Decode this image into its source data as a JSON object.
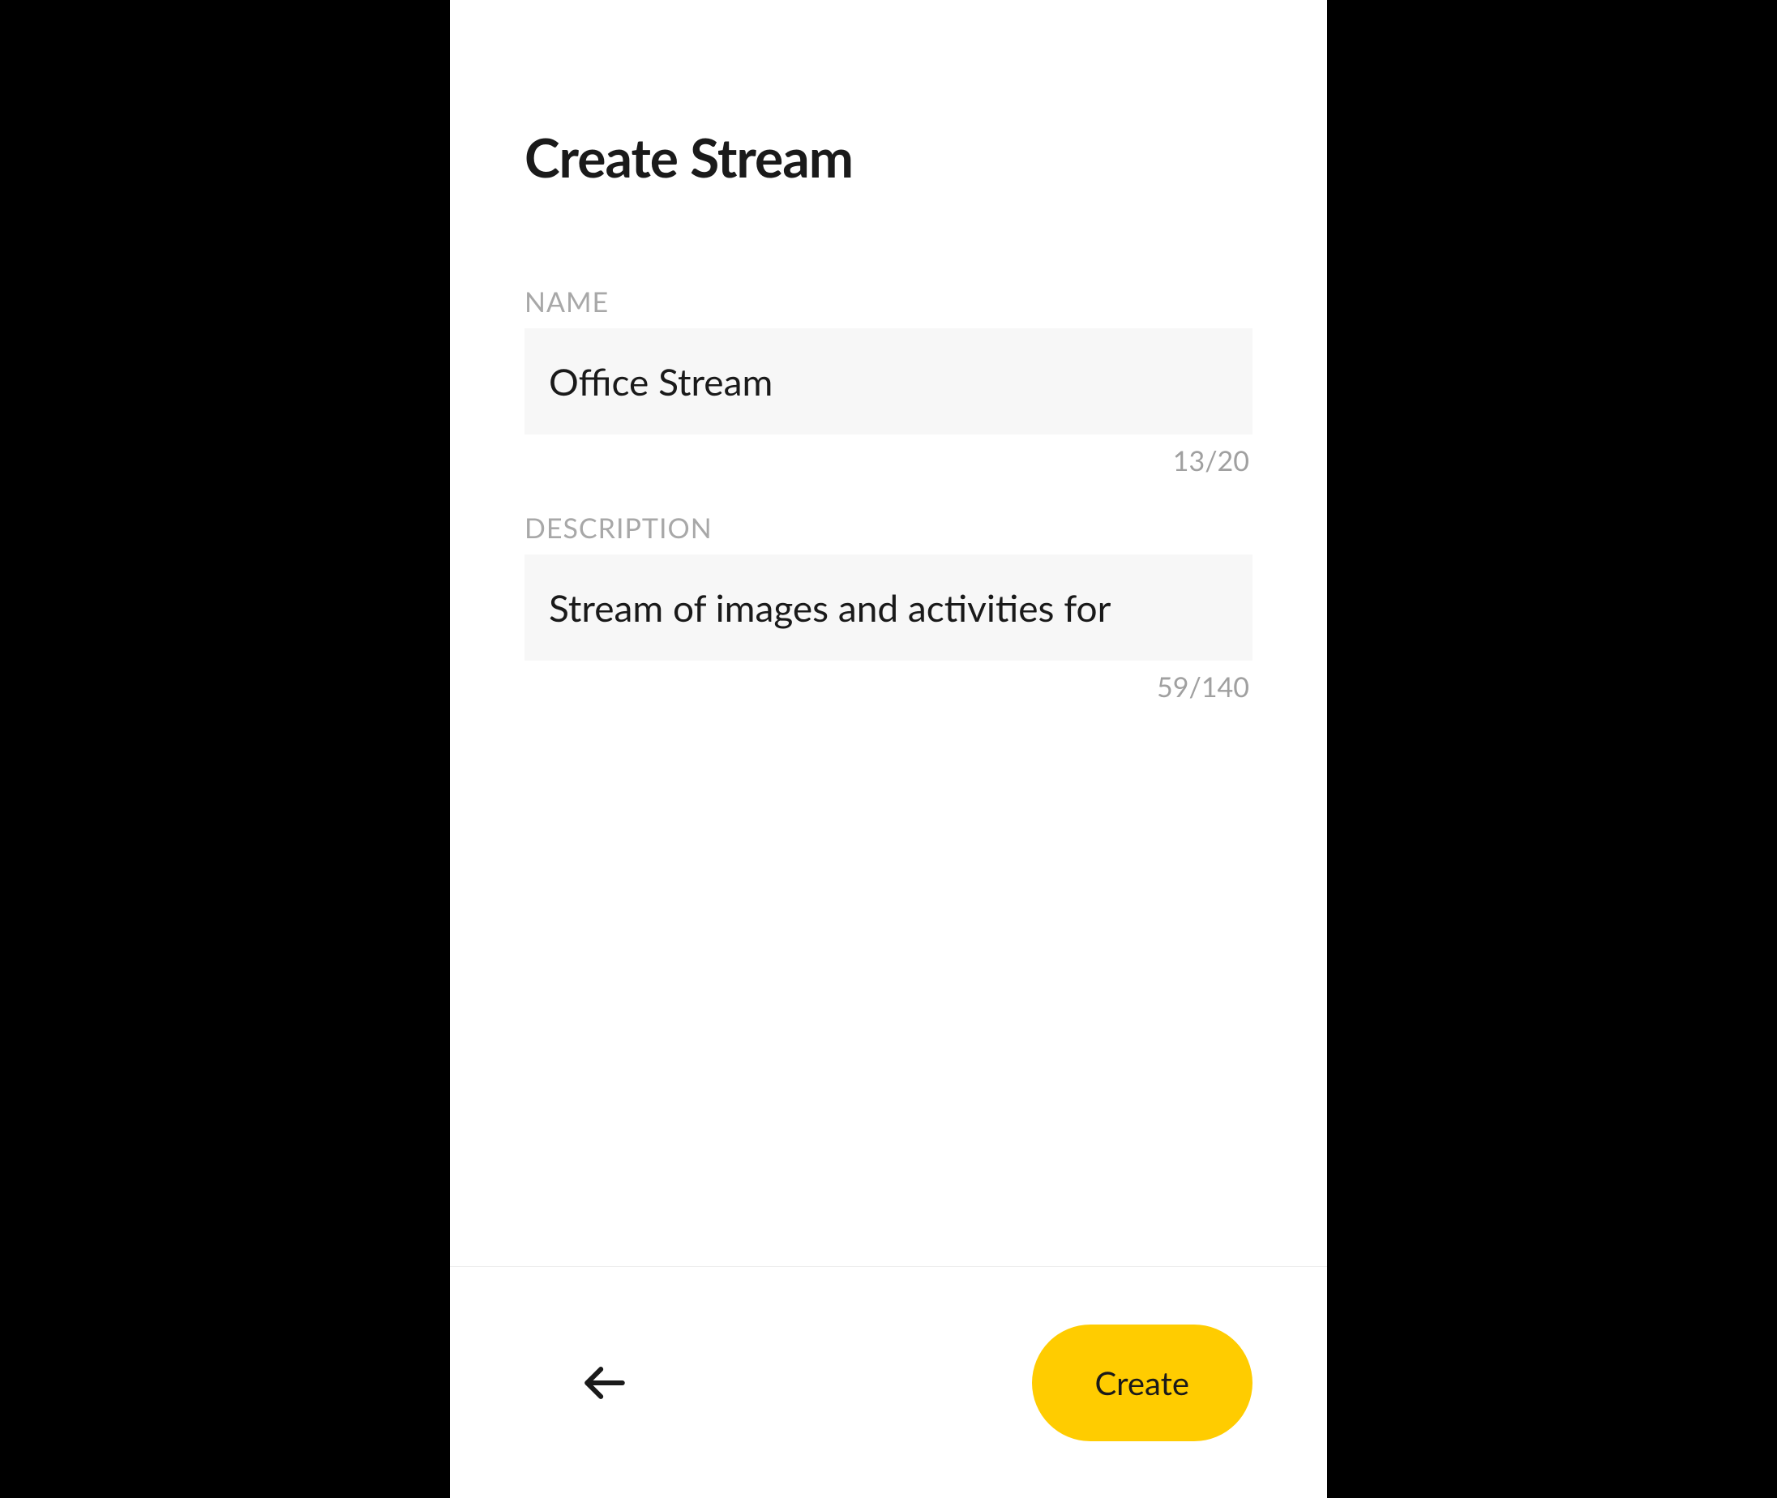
{
  "header": {
    "title": "Create Stream"
  },
  "form": {
    "name": {
      "label": "NAME",
      "value": "Office Stream",
      "counter": "13/20"
    },
    "description": {
      "label": "DESCRIPTION",
      "value": "Stream of images and activities for",
      "counter": "59/140"
    }
  },
  "footer": {
    "create_label": "Create"
  }
}
